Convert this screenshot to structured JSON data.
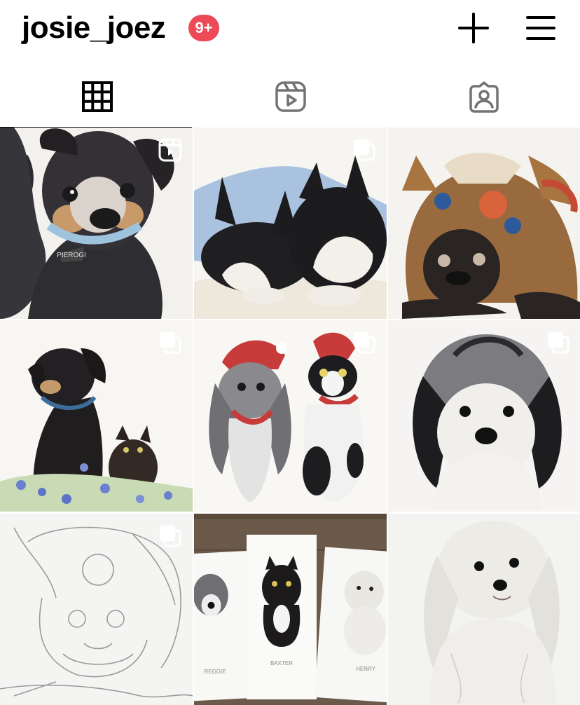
{
  "header": {
    "username": "josie_joez",
    "notification_badge": "9+",
    "badge_color": "#ed4956"
  },
  "tabs": [
    {
      "icon": "grid-icon",
      "active": true
    },
    {
      "icon": "reels-icon",
      "active": false
    },
    {
      "icon": "tagged-icon",
      "active": false
    }
  ],
  "posts": [
    {
      "subject": "puppy portrait",
      "overlay": "reels-icon"
    },
    {
      "subject": "two sleeping dogs",
      "overlay": "multiple-posts-icon"
    },
    {
      "subject": "pug in reindeer costume",
      "overlay": "none"
    },
    {
      "subject": "dog and cat in flowers",
      "overlay": "multiple-posts-icon"
    },
    {
      "subject": "dog and cat in santa hats",
      "overlay": "multiple-posts-icon"
    },
    {
      "subject": "fluffy dog portrait",
      "overlay": "multiple-posts-icon"
    },
    {
      "subject": "pencil sketch of pug",
      "overlay": "multiple-posts-icon"
    },
    {
      "subject": "painted cards",
      "overlay": "none",
      "card_labels": [
        "REGGIE",
        "BAXTER",
        "HENRY"
      ]
    },
    {
      "subject": "white fluffy dog",
      "overlay": "none"
    }
  ],
  "pet_tag_text": "PIEROGI"
}
